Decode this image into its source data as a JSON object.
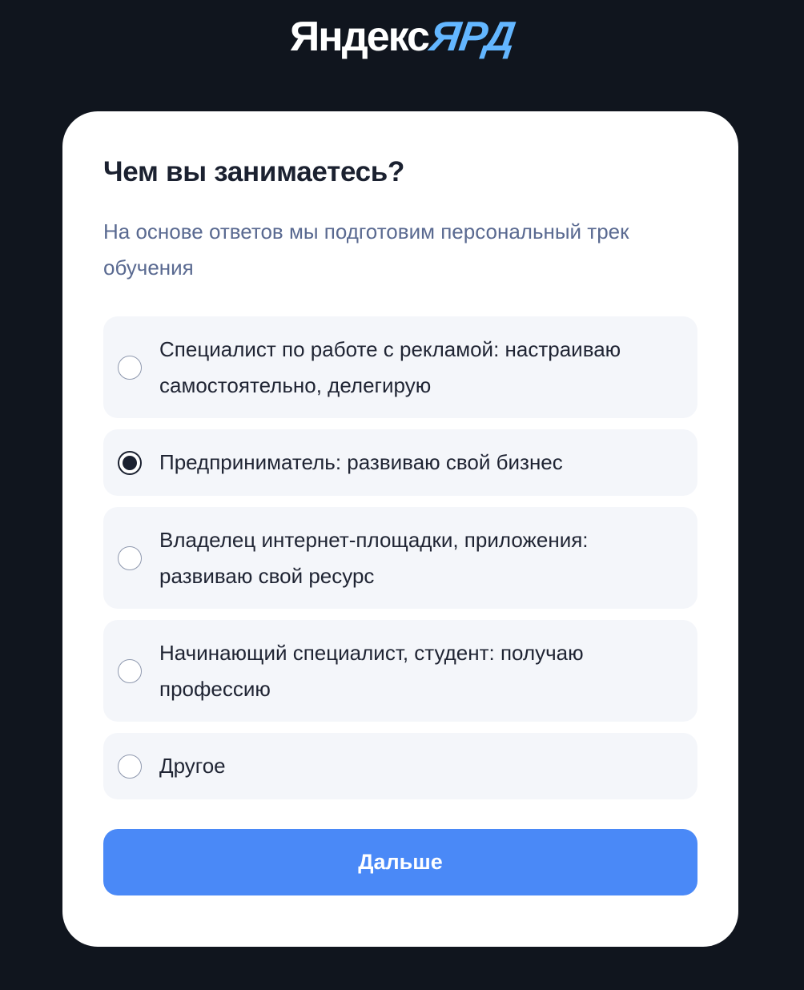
{
  "header": {
    "logo_main": "Яндекс",
    "logo_accent": "ЯРД"
  },
  "form": {
    "title": "Чем вы занимаетесь?",
    "subtitle": "На основе ответов мы подготовим персональный трек обучения",
    "options": [
      {
        "label": "Специалист по работе с рекламой: настраиваю самостоятельно, делегирую",
        "selected": false
      },
      {
        "label": "Предприниматель: развиваю свой бизнес",
        "selected": true
      },
      {
        "label": "Владелец интернет-площадки, приложения: развиваю свой ресурс",
        "selected": false
      },
      {
        "label": "Начинающий специалист, студент: получаю профессию",
        "selected": false
      },
      {
        "label": "Другое",
        "selected": false
      }
    ],
    "next_label": "Дальше"
  },
  "colors": {
    "background": "#10151e",
    "card": "#ffffff",
    "option_bg": "#f4f6fa",
    "accent_button": "#4a89f7",
    "logo_accent": "#63b6ff",
    "subtitle_text": "#5a6a91"
  }
}
